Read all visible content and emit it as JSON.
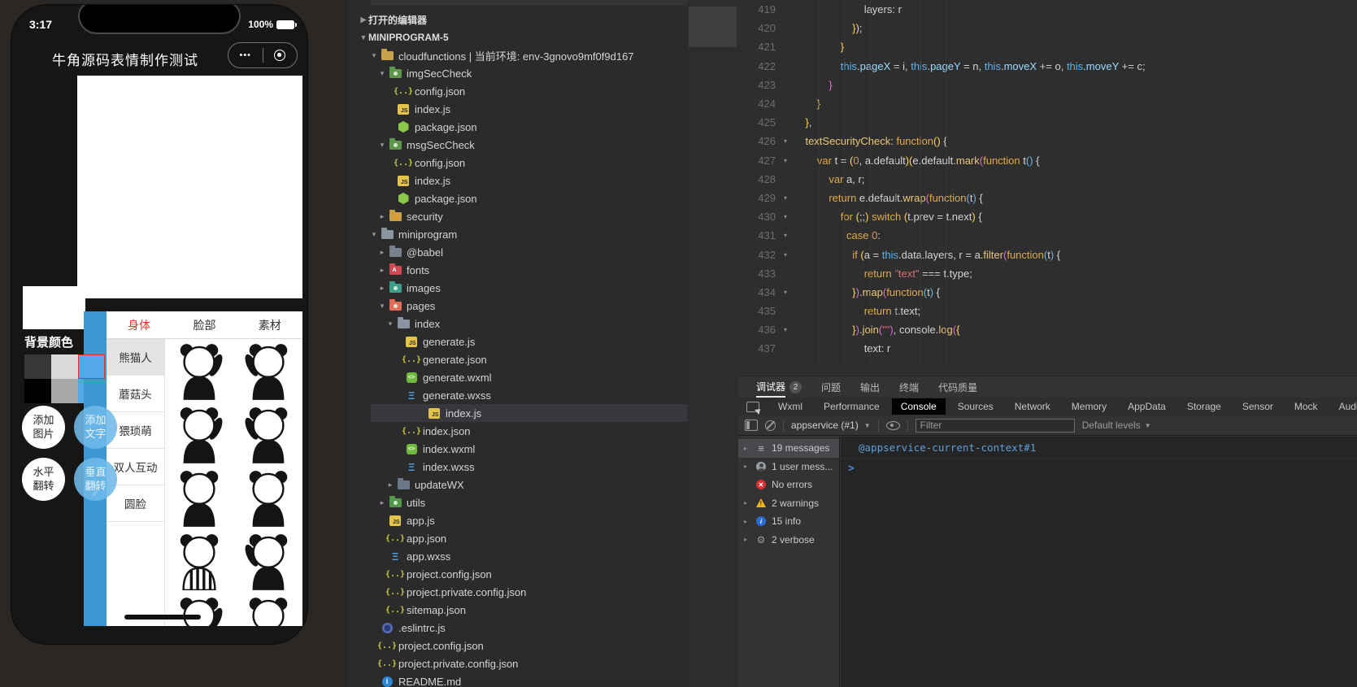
{
  "colors": {
    "strip_blue": "#3e97d0",
    "tab_active_red": "#e0392e",
    "swatch_selected_border": "#e03131",
    "console_tab_active_bg": "#000000",
    "console_link_blue": "#5f9fd8",
    "warning_yellow": "#f2b71f",
    "error_red": "#d93030",
    "info_blue": "#2b6bd4"
  },
  "simulator": {
    "status": {
      "time": "3:17",
      "battery": "100%"
    },
    "navbar": {
      "title": "牛角源码表情制作测试",
      "capsule_more": "•••"
    },
    "chevron": "❯",
    "editor_panel": {
      "bg_label": "背景颜色",
      "swatches": [
        {
          "color": "#373737",
          "selected": false
        },
        {
          "color": "#d9d9d9",
          "selected": false
        },
        {
          "color": "#54a8e8",
          "selected": true
        },
        {
          "color": "#000000",
          "selected": false
        },
        {
          "color": "#a9a9a9",
          "selected": false
        },
        {
          "color": "#54a8e8",
          "selected": false
        }
      ],
      "buttons": [
        {
          "label": "添加\n图片",
          "style": "light"
        },
        {
          "label": "添加\n文字",
          "style": "blue"
        },
        {
          "label": "水平\n翻转",
          "style": "light"
        },
        {
          "label": "垂直\n翻转",
          "style": "blue"
        }
      ]
    },
    "picker": {
      "tabs": [
        {
          "label": "身体",
          "active": true
        },
        {
          "label": "脸部",
          "active": false
        },
        {
          "label": "素材",
          "active": false
        }
      ],
      "categories": [
        {
          "label": "熊猫人",
          "selected": true
        },
        {
          "label": "蘑菇头",
          "selected": false
        },
        {
          "label": "猥琐萌",
          "selected": false
        },
        {
          "label": "双人互动",
          "selected": false
        },
        {
          "label": "圆脸",
          "selected": false
        }
      ],
      "stickers": [
        "panda-pat",
        "panda-stretch",
        "panda-point",
        "panda-flex",
        "panda-cheer",
        "panda-cheer-2",
        "panda-pajama",
        "panda-crouch",
        "panda-wave",
        "panda-peek"
      ]
    }
  },
  "explorer": {
    "sections": [
      {
        "label": "打开的编辑器",
        "arrow": "closed"
      },
      {
        "label": "MINIPROGRAM-5",
        "arrow": "open"
      }
    ],
    "tree": [
      {
        "label": "cloudfunctions | 当前环境: env-3gnovo9mf0f9d167",
        "icon": "folder",
        "fcolor": "#c7a14c",
        "arrow": "open",
        "indent": 1
      },
      {
        "label": "imgSecCheck",
        "icon": "folder",
        "fcolor": "#5d9948",
        "ov": "dot",
        "arrow": "open",
        "indent": 2
      },
      {
        "label": "config.json",
        "icon": "json",
        "indent": 3
      },
      {
        "label": "index.js",
        "icon": "js",
        "indent": 3
      },
      {
        "label": "package.json",
        "icon": "node",
        "indent": 3
      },
      {
        "label": "msgSecCheck",
        "icon": "folder",
        "fcolor": "#5d9948",
        "ov": "dot",
        "arrow": "open",
        "indent": 2
      },
      {
        "label": "config.json",
        "icon": "json",
        "indent": 3
      },
      {
        "label": "index.js",
        "icon": "js",
        "indent": 3
      },
      {
        "label": "package.json",
        "icon": "node",
        "indent": 3
      },
      {
        "label": "security",
        "icon": "folder",
        "fcolor": "#c7a14c",
        "ov": "lock",
        "arrow": "closed",
        "indent": 2
      },
      {
        "label": "miniprogram",
        "icon": "folder",
        "fcolor": "#8b95a1",
        "arrow": "open",
        "indent": 1
      },
      {
        "label": "@babel",
        "icon": "folder",
        "fcolor": "#78828c",
        "arrow": "closed",
        "indent": 2
      },
      {
        "label": "fonts",
        "icon": "folder",
        "fcolor": "#d04a56",
        "ov": "A",
        "arrow": "closed",
        "indent": 2
      },
      {
        "label": "images",
        "icon": "folder",
        "fcolor": "#3d9e8c",
        "ov": "dot",
        "arrow": "closed",
        "indent": 2
      },
      {
        "label": "pages",
        "icon": "folder",
        "fcolor": "#e06c5a",
        "ov": "dot",
        "arrow": "open",
        "indent": 2
      },
      {
        "label": "index",
        "icon": "folder",
        "fcolor": "#8b95a1",
        "arrow": "open",
        "indent": 3
      },
      {
        "label": "generate.js",
        "icon": "js",
        "indent": 4
      },
      {
        "label": "generate.json",
        "icon": "json",
        "indent": 4
      },
      {
        "label": "generate.wxml",
        "icon": "wxml",
        "indent": 4
      },
      {
        "label": "generate.wxss",
        "icon": "wxss",
        "indent": 4
      },
      {
        "label": "index.js",
        "icon": "js",
        "indent": 4,
        "selected": true
      },
      {
        "label": "index.json",
        "icon": "json",
        "indent": 4
      },
      {
        "label": "index.wxml",
        "icon": "wxml",
        "indent": 4
      },
      {
        "label": "index.wxss",
        "icon": "wxss",
        "indent": 4
      },
      {
        "label": "updateWX",
        "icon": "folder",
        "fcolor": "#6b7888",
        "arrow": "closed",
        "indent": 3
      },
      {
        "label": "utils",
        "icon": "folder",
        "fcolor": "#4f9948",
        "ov": "dot",
        "arrow": "closed",
        "indent": 2
      },
      {
        "label": "app.js",
        "icon": "js",
        "indent": 2
      },
      {
        "label": "app.json",
        "icon": "json",
        "indent": 2
      },
      {
        "label": "app.wxss",
        "icon": "wxss",
        "indent": 2
      },
      {
        "label": "project.config.json",
        "icon": "json",
        "indent": 2
      },
      {
        "label": "project.private.config.json",
        "icon": "json",
        "indent": 2
      },
      {
        "label": "sitemap.json",
        "icon": "json",
        "indent": 2
      },
      {
        "label": ".eslintrc.js",
        "icon": "eslint",
        "indent": 1
      },
      {
        "label": "project.config.json",
        "icon": "json",
        "indent": 1
      },
      {
        "label": "project.private.config.json",
        "icon": "json",
        "indent": 1
      },
      {
        "label": "README.md",
        "icon": "info",
        "indent": 1
      }
    ]
  },
  "editor": {
    "lines": [
      {
        "n": 419,
        "fold": false,
        "ind": 24,
        "toks": [
          [
            "pl",
            "layers: r"
          ]
        ]
      },
      {
        "n": 420,
        "fold": false,
        "ind": 20,
        "toks": [
          [
            "b1",
            "})"
          ],
          [
            "pl",
            ";"
          ]
        ]
      },
      {
        "n": 421,
        "fold": false,
        "ind": 16,
        "toks": [
          [
            "b1",
            "}"
          ]
        ]
      },
      {
        "n": 422,
        "fold": false,
        "ind": 16,
        "toks": [
          [
            "th",
            "this"
          ],
          [
            "pl",
            "."
          ],
          [
            "pr",
            "pageX"
          ],
          [
            "op",
            " = "
          ],
          [
            "pl",
            "i"
          ],
          [
            "op",
            ", "
          ],
          [
            "th",
            "this"
          ],
          [
            "pl",
            "."
          ],
          [
            "pr",
            "pageY"
          ],
          [
            "op",
            " = "
          ],
          [
            "pl",
            "n"
          ],
          [
            "op",
            ", "
          ],
          [
            "th",
            "this"
          ],
          [
            "pl",
            "."
          ],
          [
            "pr",
            "moveX"
          ],
          [
            "op",
            " += "
          ],
          [
            "pl",
            "o"
          ],
          [
            "op",
            ", "
          ],
          [
            "th",
            "this"
          ],
          [
            "pl",
            "."
          ],
          [
            "pr",
            "moveY"
          ],
          [
            "op",
            " += "
          ],
          [
            "pl",
            "c"
          ],
          [
            "pl",
            ";"
          ]
        ]
      },
      {
        "n": 423,
        "fold": false,
        "ind": 12,
        "toks": [
          [
            "b2",
            "}"
          ]
        ]
      },
      {
        "n": 424,
        "fold": false,
        "ind": 8,
        "toks": [
          [
            "b1",
            "}"
          ]
        ]
      },
      {
        "n": 425,
        "fold": false,
        "ind": 4,
        "toks": [
          [
            "b1",
            "}"
          ],
          [
            "pl",
            ","
          ]
        ]
      },
      {
        "n": 426,
        "fold": true,
        "ind": 4,
        "toks": [
          [
            "fn",
            "textSecurityCheck"
          ],
          [
            "pl",
            ": "
          ],
          [
            "kw",
            "function"
          ],
          [
            "b1",
            "()"
          ],
          [
            "pl",
            " {"
          ]
        ]
      },
      {
        "n": 427,
        "fold": true,
        "ind": 8,
        "toks": [
          [
            "kw",
            "var"
          ],
          [
            "pl",
            " t = "
          ],
          [
            "b1",
            "("
          ],
          [
            "nu",
            "0"
          ],
          [
            "pl",
            ", a.default"
          ],
          [
            "b1",
            ")("
          ],
          [
            "pl",
            "e.default."
          ],
          [
            "fn",
            "mark"
          ],
          [
            "b2",
            "("
          ],
          [
            "kw",
            "function"
          ],
          [
            "pl",
            " t"
          ],
          [
            "b3",
            "()"
          ],
          [
            "pl",
            " {"
          ]
        ]
      },
      {
        "n": 428,
        "fold": false,
        "ind": 12,
        "toks": [
          [
            "kw",
            "var"
          ],
          [
            "pl",
            " a, r;"
          ]
        ]
      },
      {
        "n": 429,
        "fold": true,
        "ind": 12,
        "toks": [
          [
            "kw",
            "return"
          ],
          [
            "pl",
            " e.default."
          ],
          [
            "fn",
            "wrap"
          ],
          [
            "b2",
            "("
          ],
          [
            "kw",
            "function"
          ],
          [
            "b3",
            "("
          ],
          [
            "pl",
            "t"
          ],
          [
            "b3",
            ")"
          ],
          [
            "pl",
            " {"
          ]
        ]
      },
      {
        "n": 430,
        "fold": true,
        "ind": 16,
        "toks": [
          [
            "kw",
            "for"
          ],
          [
            "pl",
            " "
          ],
          [
            "b1",
            "("
          ],
          [
            "pl",
            ";;"
          ],
          [
            "b1",
            ")"
          ],
          [
            "pl",
            " "
          ],
          [
            "kw",
            "switch"
          ],
          [
            "pl",
            " "
          ],
          [
            "b1",
            "("
          ],
          [
            "pl",
            "t.prev = t.next"
          ],
          [
            "b1",
            ")"
          ],
          [
            "pl",
            " {"
          ]
        ]
      },
      {
        "n": 431,
        "fold": true,
        "ind": 18,
        "toks": [
          [
            "kw",
            "case"
          ],
          [
            "pl",
            " "
          ],
          [
            "nu",
            "0"
          ],
          [
            "pl",
            ":"
          ]
        ]
      },
      {
        "n": 432,
        "fold": true,
        "ind": 20,
        "toks": [
          [
            "kw",
            "if"
          ],
          [
            "pl",
            " "
          ],
          [
            "b1",
            "("
          ],
          [
            "pl",
            "a = "
          ],
          [
            "th",
            "this"
          ],
          [
            "pl",
            ".data.layers, r = a."
          ],
          [
            "fn",
            "filter"
          ],
          [
            "b2",
            "("
          ],
          [
            "kw",
            "function"
          ],
          [
            "b3",
            "("
          ],
          [
            "pl",
            "t"
          ],
          [
            "b3",
            ")"
          ],
          [
            "pl",
            " {"
          ]
        ]
      },
      {
        "n": 433,
        "fold": false,
        "ind": 24,
        "toks": [
          [
            "kw",
            "return"
          ],
          [
            "pl",
            " "
          ],
          [
            "st",
            "\"text\""
          ],
          [
            "op",
            " === "
          ],
          [
            "pl",
            "t.type;"
          ]
        ]
      },
      {
        "n": 434,
        "fold": true,
        "ind": 20,
        "toks": [
          [
            "b1",
            "}"
          ],
          [
            "b2",
            ")"
          ],
          [
            "pl",
            "."
          ],
          [
            "fn",
            "map"
          ],
          [
            "b2",
            "("
          ],
          [
            "kw",
            "function"
          ],
          [
            "b3",
            "("
          ],
          [
            "pl",
            "t"
          ],
          [
            "b3",
            ")"
          ],
          [
            "pl",
            " {"
          ]
        ]
      },
      {
        "n": 435,
        "fold": false,
        "ind": 24,
        "toks": [
          [
            "kw",
            "return"
          ],
          [
            "pl",
            " t.text;"
          ]
        ]
      },
      {
        "n": 436,
        "fold": true,
        "ind": 20,
        "toks": [
          [
            "b1",
            "}"
          ],
          [
            "b2",
            ")"
          ],
          [
            "pl",
            "."
          ],
          [
            "fn",
            "join"
          ],
          [
            "b2",
            "("
          ],
          [
            "st",
            "\"\""
          ],
          [
            "b2",
            ")"
          ],
          [
            "pl",
            ", console."
          ],
          [
            "fn",
            "log"
          ],
          [
            "b2",
            "("
          ],
          [
            "b1",
            "{"
          ]
        ]
      },
      {
        "n": 437,
        "fold": false,
        "ind": 24,
        "toks": [
          [
            "pl",
            "text: r"
          ]
        ]
      }
    ]
  },
  "debugger": {
    "panel_tabs": [
      {
        "label": "调试器",
        "badge": "2",
        "active": true
      },
      {
        "label": "问题"
      },
      {
        "label": "输出"
      },
      {
        "label": "终端"
      },
      {
        "label": "代码质量"
      }
    ],
    "devtools_tabs": [
      {
        "label": "Wxml"
      },
      {
        "label": "Performance"
      },
      {
        "label": "Console",
        "active": true
      },
      {
        "label": "Sources"
      },
      {
        "label": "Network"
      },
      {
        "label": "Memory"
      },
      {
        "label": "AppData"
      },
      {
        "label": "Storage"
      },
      {
        "label": "Sensor"
      },
      {
        "label": "Mock"
      },
      {
        "label": "Audits"
      }
    ],
    "toolbar": {
      "context": "appservice (#1)",
      "filter_placeholder": "Filter",
      "levels": "Default levels"
    },
    "sidebar": [
      {
        "icon": "list",
        "label": "19 messages",
        "arrow": true,
        "selected": true
      },
      {
        "icon": "user",
        "label": "1 user mess...",
        "arrow": true
      },
      {
        "icon": "error",
        "label": "No errors",
        "arrow": false
      },
      {
        "icon": "warning",
        "label": "2 warnings",
        "arrow": true
      },
      {
        "icon": "info",
        "label": "15 info",
        "arrow": true
      },
      {
        "icon": "verbose",
        "label": "2 verbose",
        "arrow": true
      }
    ],
    "console": {
      "context_link": "@appservice-current-context#1",
      "prompt": ">"
    }
  }
}
